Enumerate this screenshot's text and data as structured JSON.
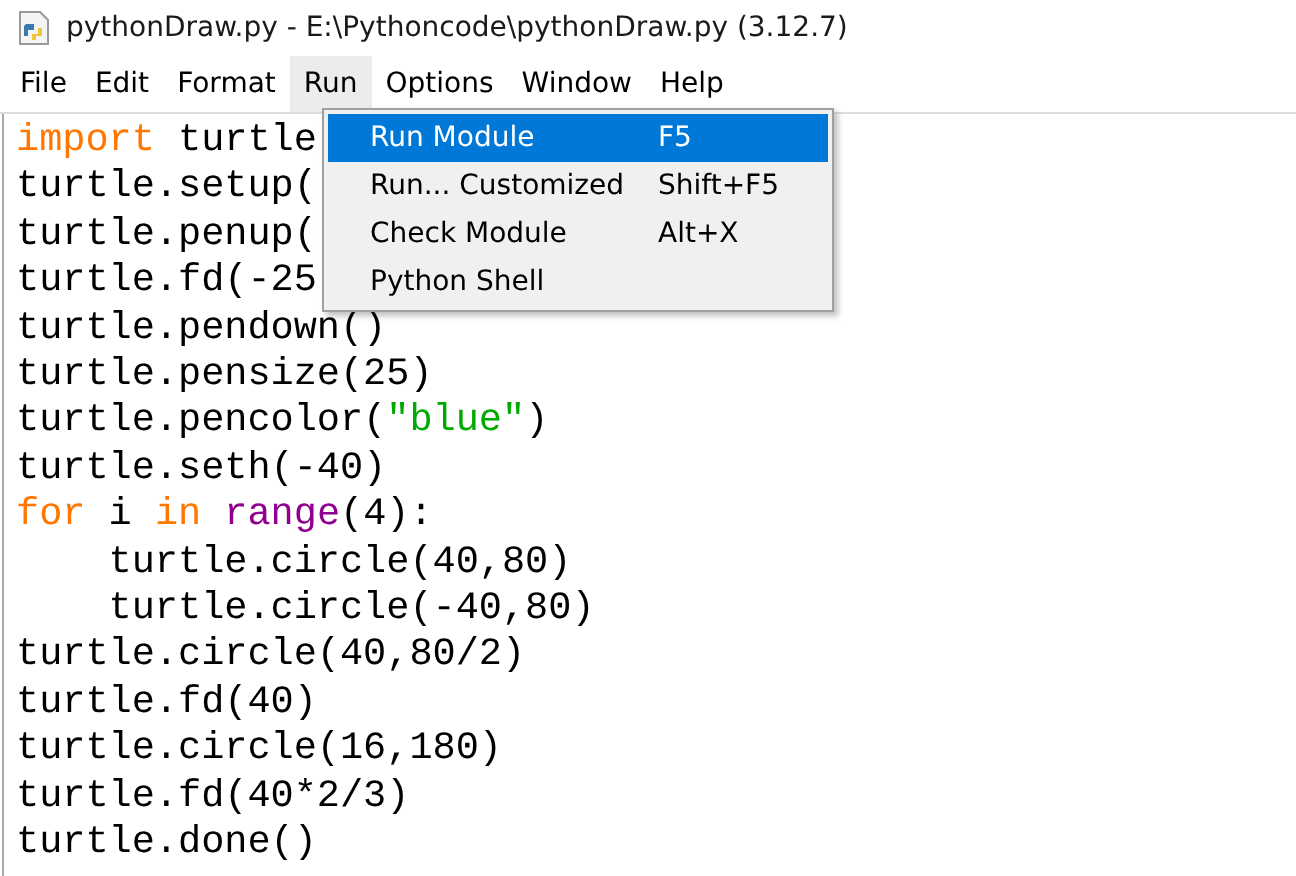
{
  "window": {
    "title": "pythonDraw.py - E:\\Pythoncode\\pythonDraw.py (3.12.7)"
  },
  "menubar": [
    {
      "label": "File",
      "selected": false
    },
    {
      "label": "Edit",
      "selected": false
    },
    {
      "label": "Format",
      "selected": false
    },
    {
      "label": "Run",
      "selected": true
    },
    {
      "label": "Options",
      "selected": false
    },
    {
      "label": "Window",
      "selected": false
    },
    {
      "label": "Help",
      "selected": false
    }
  ],
  "menu": [
    {
      "label": "Run Module",
      "shortcut": "F5",
      "selected": true
    },
    {
      "label": "Run... Customized",
      "shortcut": "Shift+F5",
      "selected": false
    },
    {
      "label": "Check Module",
      "shortcut": "Alt+X",
      "selected": false
    },
    {
      "label": "Python Shell",
      "selected": false
    }
  ],
  "code": [
    [
      {
        "text": "import",
        "kind": "keyword"
      },
      {
        "text": " turtle",
        "kind": "plain"
      }
    ],
    [
      {
        "text": "turtle.setup(",
        "kind": "plain"
      }
    ],
    [
      {
        "text": "turtle.penup(",
        "kind": "plain"
      }
    ],
    [
      {
        "text": "turtle.fd(-25",
        "kind": "plain"
      }
    ],
    [
      {
        "text": "turtle.pendown()",
        "kind": "plain"
      }
    ],
    [
      {
        "text": "turtle.pensize(25)",
        "kind": "plain"
      }
    ],
    [
      {
        "text": "turtle.pencolor(",
        "kind": "plain"
      },
      {
        "text": "\"blue\"",
        "kind": "string"
      },
      {
        "text": ")",
        "kind": "plain"
      }
    ],
    [
      {
        "text": "turtle.seth(-40)",
        "kind": "plain"
      }
    ],
    [
      {
        "text": "for",
        "kind": "keyword"
      },
      {
        "text": " i ",
        "kind": "plain"
      },
      {
        "text": "in",
        "kind": "keyword"
      },
      {
        "text": " range",
        "kind": "builtin"
      },
      {
        "text": "(4):",
        "kind": "plain"
      }
    ],
    [
      {
        "text": "    turtle.circle(40,80)",
        "kind": "plain"
      }
    ],
    [
      {
        "text": "    turtle.circle(-40,80)",
        "kind": "plain"
      }
    ],
    [
      {
        "text": "turtle.circle(40,80/2)",
        "kind": "plain"
      }
    ],
    [
      {
        "text": "turtle.fd(40)",
        "kind": "plain"
      }
    ],
    [
      {
        "text": "turtle.circle(16,180)",
        "kind": "plain"
      }
    ],
    [
      {
        "text": "turtle.fd(40*2/3)",
        "kind": "plain"
      }
    ],
    [
      {
        "text": "turtle.done()",
        "kind": "plain"
      }
    ]
  ]
}
